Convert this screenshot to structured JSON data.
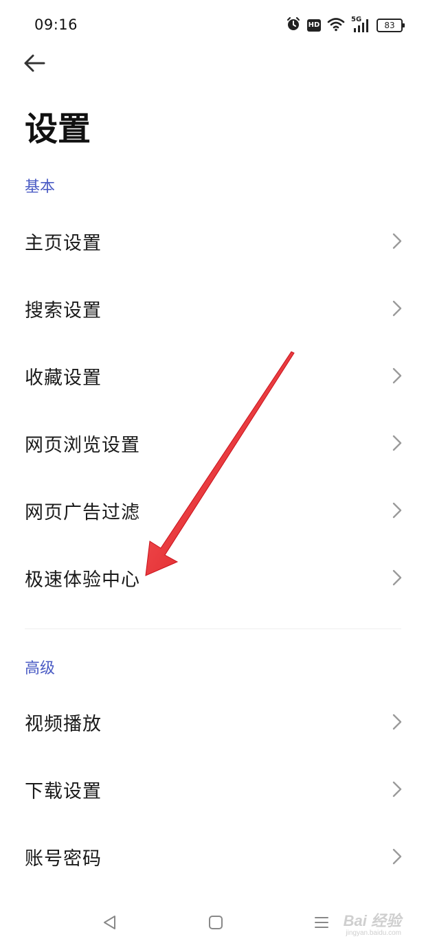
{
  "status_bar": {
    "time": "09:16",
    "battery": "83",
    "icons": [
      "alarm-icon",
      "hd-icon",
      "wifi-icon",
      "signal-5g-icon",
      "battery-icon"
    ],
    "network_label": "5G",
    "hd_label": "HD"
  },
  "header": {
    "back_icon": "arrow-left-icon",
    "title": "设置"
  },
  "sections": [
    {
      "title": "基本",
      "items": [
        {
          "label": "主页设置"
        },
        {
          "label": "搜索设置"
        },
        {
          "label": "收藏设置"
        },
        {
          "label": "网页浏览设置"
        },
        {
          "label": "网页广告过滤"
        },
        {
          "label": "极速体验中心"
        }
      ]
    },
    {
      "title": "高级",
      "items": [
        {
          "label": "视频播放"
        },
        {
          "label": "下载设置"
        },
        {
          "label": "账号密码"
        }
      ]
    }
  ],
  "nav_bar": {
    "buttons": [
      "back-triangle-icon",
      "home-square-icon",
      "menu-lines-icon"
    ]
  },
  "watermark": {
    "main": "Bai 经验",
    "sub": "jingyan.baidu.com"
  },
  "colors": {
    "accent": "#4a5bc4",
    "annotation_arrow": "#e8141b",
    "text": "#1a1a1a",
    "chevron": "#9a9a9a"
  }
}
